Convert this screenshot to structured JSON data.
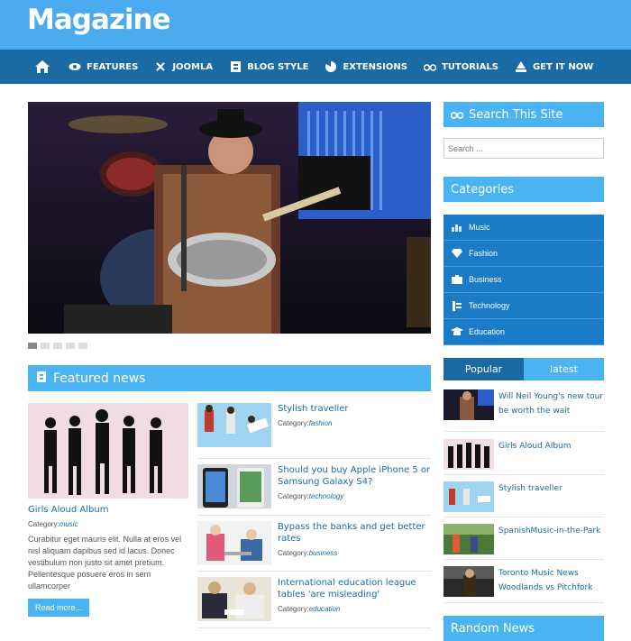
{
  "site": {
    "logo": "Magazine"
  },
  "nav": [
    {
      "label": "FEATURES",
      "icon": "eye-icon"
    },
    {
      "label": "JOOMLA",
      "icon": "joomla-icon"
    },
    {
      "label": "BLOG STYLE",
      "icon": "blog-icon"
    },
    {
      "label": "EXTENSIONS",
      "icon": "pie-icon"
    },
    {
      "label": "TUTORIALS",
      "icon": "glasses-icon"
    },
    {
      "label": "GET IT NOW",
      "icon": "download-icon"
    }
  ],
  "featured": {
    "heading": "Featured news",
    "main": {
      "title": "Girls Aloud Album",
      "category_label": "Category:",
      "category": "music",
      "body": "Curabitur eget mauris elit. Nulla at eros vel nisl aliquam dapibus sed id lacus. Donec vestibulum non justo sit amet pretium. Pellentesque posuere eros in sem ullamcorper",
      "read_more": "Read more..."
    },
    "items": [
      {
        "title": "Stylish traveller",
        "category": "fashion"
      },
      {
        "title": "Should you buy Apple iPhone 5 or Samsung Galaxy S4?",
        "category": "technology"
      },
      {
        "title": "Bypass the banks and get better rates",
        "category": "business"
      },
      {
        "title": "International education league tables 'are misleading'",
        "category": "education"
      }
    ]
  },
  "sidebar": {
    "search_heading": "Search This Site",
    "search_placeholder": "Search ...",
    "categories_heading": "Categories",
    "categories": [
      {
        "label": "Music",
        "icon": "chart-icon"
      },
      {
        "label": "Fashion",
        "icon": "diamond-icon"
      },
      {
        "label": "Business",
        "icon": "briefcase-icon"
      },
      {
        "label": "Technology",
        "icon": "server-icon"
      },
      {
        "label": "Education",
        "icon": "graduation-cap-icon"
      }
    ],
    "tabs": {
      "popular": "Popular",
      "latest": "latest"
    },
    "popular": [
      {
        "title": "Will Neil Young's new tour be worth the wait"
      },
      {
        "title": "Girls Aloud Album"
      },
      {
        "title": "Stylish traveller"
      },
      {
        "title": "SpanishMusic-in-the-Park"
      },
      {
        "title": "Toronto Music News Woodlands vs Pitchfork"
      }
    ],
    "random_heading": "Random News"
  },
  "colors": {
    "light_blue": "#4ab3f1",
    "dark_blue": "#1a6aa5",
    "top_blue": "#4aaaee"
  }
}
